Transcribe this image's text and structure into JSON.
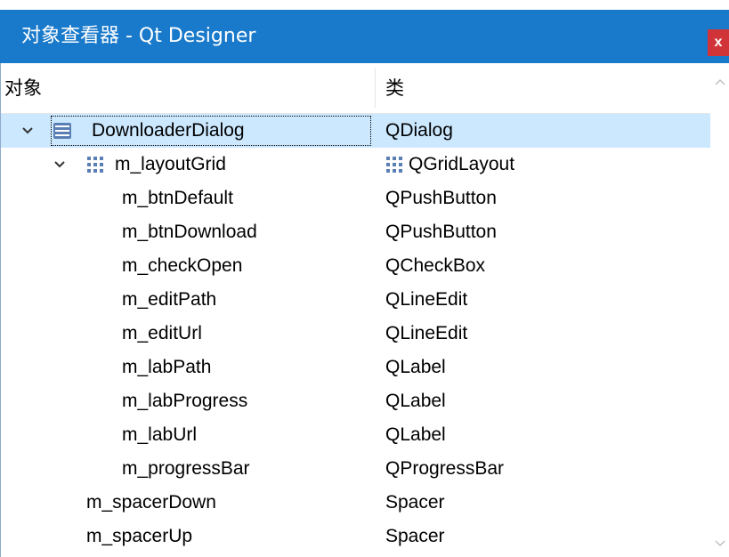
{
  "window": {
    "title": "对象查看器 - Qt Designer",
    "close_label": "x"
  },
  "header": {
    "object_col": "对象",
    "class_col": "类"
  },
  "rows": [
    {
      "name": "DownloaderDialog",
      "class": "QDialog"
    },
    {
      "name": "m_layoutGrid",
      "class": "QGridLayout"
    },
    {
      "name": "m_btnDefault",
      "class": "QPushButton"
    },
    {
      "name": "m_btnDownload",
      "class": "QPushButton"
    },
    {
      "name": "m_checkOpen",
      "class": "QCheckBox"
    },
    {
      "name": "m_editPath",
      "class": "QLineEdit"
    },
    {
      "name": "m_editUrl",
      "class": "QLineEdit"
    },
    {
      "name": "m_labPath",
      "class": "QLabel"
    },
    {
      "name": "m_labProgress",
      "class": "QLabel"
    },
    {
      "name": "m_labUrl",
      "class": "QLabel"
    },
    {
      "name": "m_progressBar",
      "class": "QProgressBar"
    },
    {
      "name": "m_spacerDown",
      "class": "Spacer"
    },
    {
      "name": "m_spacerUp",
      "class": "Spacer"
    }
  ],
  "icons": {
    "expand": "chevron-down-icon",
    "dialog": "dialog-form-icon",
    "grid": "grid-layout-icon"
  },
  "colors": {
    "titlebar": "#1979ca",
    "selection": "#cce8ff",
    "close": "#d13438"
  }
}
